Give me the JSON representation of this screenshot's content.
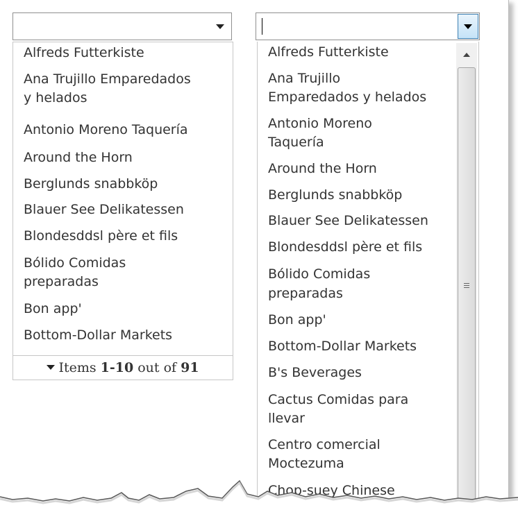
{
  "left_combo": {
    "value": "",
    "items": [
      "Alfreds Futterkiste",
      "Ana Trujillo Emparedados",
      "y helados",
      "Antonio Moreno Taquería",
      "Around the Horn",
      "Berglunds snabbköp",
      "Blauer See Delikatessen",
      "Blondesddsl père et fils",
      "Bólido Comidas",
      "preparadas",
      "Bon app'",
      "Bottom-Dollar Markets"
    ],
    "footer": {
      "prefix": "Items",
      "range": "1-10",
      "middle": "out of",
      "total": "91"
    }
  },
  "right_combo": {
    "value": "",
    "items": [
      "Alfreds Futterkiste",
      "Ana Trujillo",
      "Emparedados y helados",
      "Antonio Moreno",
      "Taquería",
      "Around the Horn",
      "Berglunds snabbköp",
      "Blauer See Delikatessen",
      "Blondesddsl père et fils",
      "Bólido Comidas",
      "preparadas",
      "Bon app'",
      "Bottom-Dollar Markets",
      "B's Beverages",
      "Cactus Comidas para",
      "llevar",
      "Centro comercial",
      "Moctezuma",
      "Chop-suey Chinese"
    ]
  },
  "icons": {
    "dropdown": "chevron-down-icon",
    "scroll_up": "scroll-up-arrow-icon",
    "grip": "scroll-grip-icon"
  }
}
